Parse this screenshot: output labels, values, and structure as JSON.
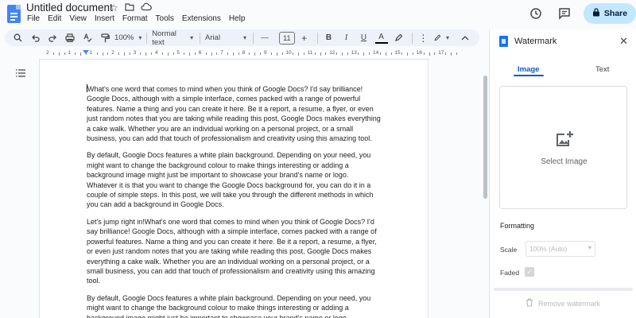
{
  "app": {
    "doc_title": "Untitled document",
    "menu": [
      "File",
      "Edit",
      "View",
      "Insert",
      "Format",
      "Tools",
      "Extensions",
      "Help"
    ],
    "share_label": "Share"
  },
  "toolbar": {
    "zoom": "100%",
    "style": "Normal text",
    "font": "Arial",
    "font_size": "11",
    "minus": "—",
    "plus": "+",
    "bold": "B",
    "italic": "I",
    "underline": "U",
    "text_color": "A"
  },
  "ruler": {
    "numbers": [
      "2",
      "1",
      "1",
      "2",
      "3",
      "4",
      "5",
      "6",
      "7",
      "8",
      "9",
      "10",
      "11",
      "12",
      "13",
      "14",
      "15",
      "16",
      "17"
    ]
  },
  "document": {
    "paragraphs": [
      "What's one word that comes to mind when you think of Google Docs? I'd say brilliance! Google Docs, although with a simple interface, comes packed with a range of powerful features. Name a thing and you can create it here. Be it a report, a resume, a flyer, or even just random notes that you are taking while reading this post, Google Docs makes everything a cake walk. Whether you are an individual working on a personal project, or a small business, you can add that touch of professionalism and creativity using this amazing tool.",
      "By default, Google Docs features a white plain background. Depending on your need, you might want to change the background colour to make things interesting or adding a background image might just be important to showcase your brand's name or logo. Whatever it is that you want to change the Google Docs background for, you can do it in a couple of simple steps. In this post, we will take you through the different methods in which you can add a background in Google Docs.",
      "Let's jump right in!What's one word that comes to mind when you think of Google Docs? I'd say brilliance! Google Docs, although with a simple interface, comes packed with a range of powerful features. Name a thing and you can create it here. Be it a report, a resume, a flyer, or even just random notes that you are taking while reading this post, Google Docs makes everything a cake walk. Whether you are an individual working on a personal project, or a small business, you can add that touch of professionalism and creativity using this amazing tool.",
      "By default, Google Docs features a white plain background. Depending on your need, you might want to change the background colour to make things interesting or adding a background image might just be important to showcase your brand's name or logo."
    ]
  },
  "panel": {
    "title": "Watermark",
    "tabs": [
      "Image",
      "Text"
    ],
    "active_tab": "Image",
    "select_image": "Select Image",
    "formatting_label": "Formatting",
    "scale_label": "Scale",
    "scale_value": "100% (Auto)",
    "faded_label": "Faded",
    "faded_checked": true,
    "remove_label": "Remove watermark"
  },
  "colors": {
    "accent": "#0b57d0",
    "share_bg": "#c2e7ff",
    "toolbar_bg": "#edf2fa",
    "docs_blue": "#4285f4"
  }
}
